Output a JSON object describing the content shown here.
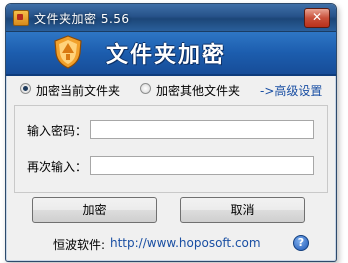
{
  "window": {
    "title": "文件夹加密 5.56",
    "close_glyph": "✕"
  },
  "banner": {
    "title": "文件夹加密",
    "icon": "shield-logo"
  },
  "options": {
    "encrypt_current": {
      "label": "加密当前文件夹",
      "selected": true
    },
    "encrypt_other": {
      "label": "加密其他文件夹",
      "selected": false
    },
    "advanced_link": "->高级设置"
  },
  "form": {
    "password_label": "输入密码：",
    "password_value": "",
    "confirm_label": "再次输入：",
    "confirm_value": ""
  },
  "buttons": {
    "encrypt": "加密",
    "cancel": "取消"
  },
  "footer": {
    "label": "恒波软件:",
    "url": "http://www.hoposoft.com",
    "help_glyph": "?"
  },
  "colors": {
    "banner_blue": "#1c5dae",
    "link_blue": "#1a4fa3",
    "shield_orange": "#f2a12b",
    "close_red": "#c9503a"
  }
}
